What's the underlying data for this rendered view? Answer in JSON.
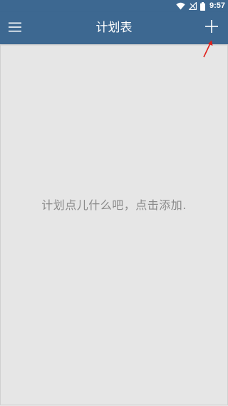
{
  "status_bar": {
    "time": "9:57",
    "icons": [
      "wifi-icon",
      "signal-no-sim-icon",
      "battery-icon"
    ]
  },
  "app_bar": {
    "title": "计划表",
    "menu_icon": "hamburger-menu-icon",
    "add_icon": "plus-icon"
  },
  "main": {
    "empty_message": "计划点儿什么吧，点击添加."
  },
  "colors": {
    "primary": "#3d6891",
    "background": "#e6e6e6",
    "empty_text": "#8a8a8a",
    "annotation": "#e0201b"
  }
}
